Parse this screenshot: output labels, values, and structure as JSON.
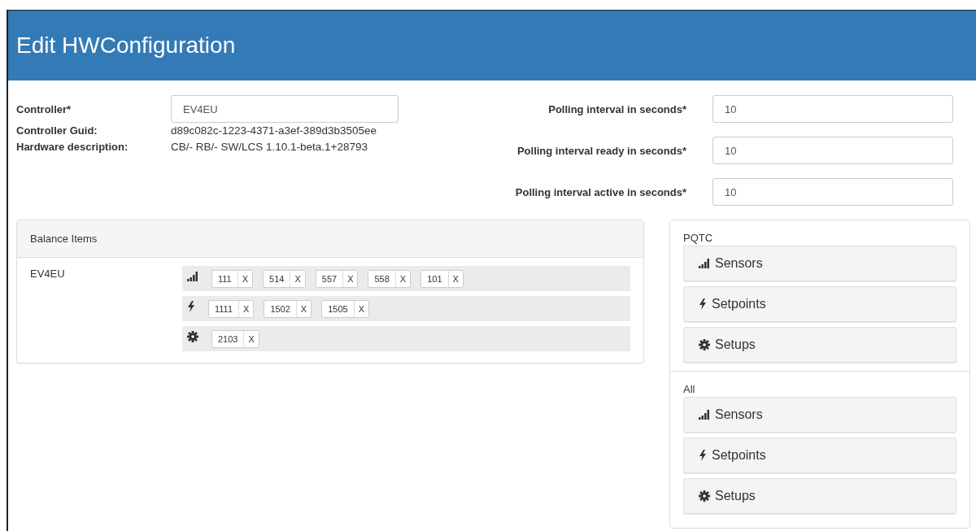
{
  "window": {
    "title": "Edit HWConfiguration"
  },
  "controller": {
    "label": "Controller*",
    "value": "EV4EU"
  },
  "info": [
    {
      "label": "Controller Guid:",
      "value": "d89c082c-1223-4371-a3ef-389d3b3505ee"
    },
    {
      "label": "Hardware description:",
      "value": "CB/- RB/- SW/LCS 1.10.1-beta.1+28793"
    }
  ],
  "polling": [
    {
      "label": "Polling interval in seconds*",
      "value": "10"
    },
    {
      "label": "Polling interval ready in seconds*",
      "value": "10"
    },
    {
      "label": "Polling interval active in seconds*",
      "value": "10"
    }
  ],
  "balance_items": {
    "title": "Balance Items",
    "name": "EV4EU",
    "groups": [
      {
        "kind": "sensors",
        "tags": [
          {
            "value": "111",
            "remove": "X"
          },
          {
            "value": "514",
            "remove": "X"
          },
          {
            "value": "557",
            "remove": "X"
          },
          {
            "value": "558",
            "remove": "X"
          },
          {
            "value": "101",
            "remove": "X"
          }
        ]
      },
      {
        "kind": "setpoints",
        "tags": [
          {
            "value": "1111",
            "remove": "X"
          },
          {
            "value": "1502",
            "remove": "X"
          },
          {
            "value": "1505",
            "remove": "X"
          }
        ]
      },
      {
        "kind": "setups",
        "tags": [
          {
            "value": "2103",
            "remove": "X"
          }
        ]
      }
    ]
  },
  "sources": [
    {
      "title": "PQTC",
      "buttons": [
        {
          "kind": "sensors",
          "label": "Sensors"
        },
        {
          "kind": "setpoints",
          "label": "Setpoints"
        },
        {
          "kind": "setups",
          "label": "Setups"
        }
      ]
    },
    {
      "title": "All",
      "buttons": [
        {
          "kind": "sensors",
          "label": "Sensors"
        },
        {
          "kind": "setpoints",
          "label": "Setpoints"
        },
        {
          "kind": "setups",
          "label": "Setups"
        }
      ]
    }
  ]
}
